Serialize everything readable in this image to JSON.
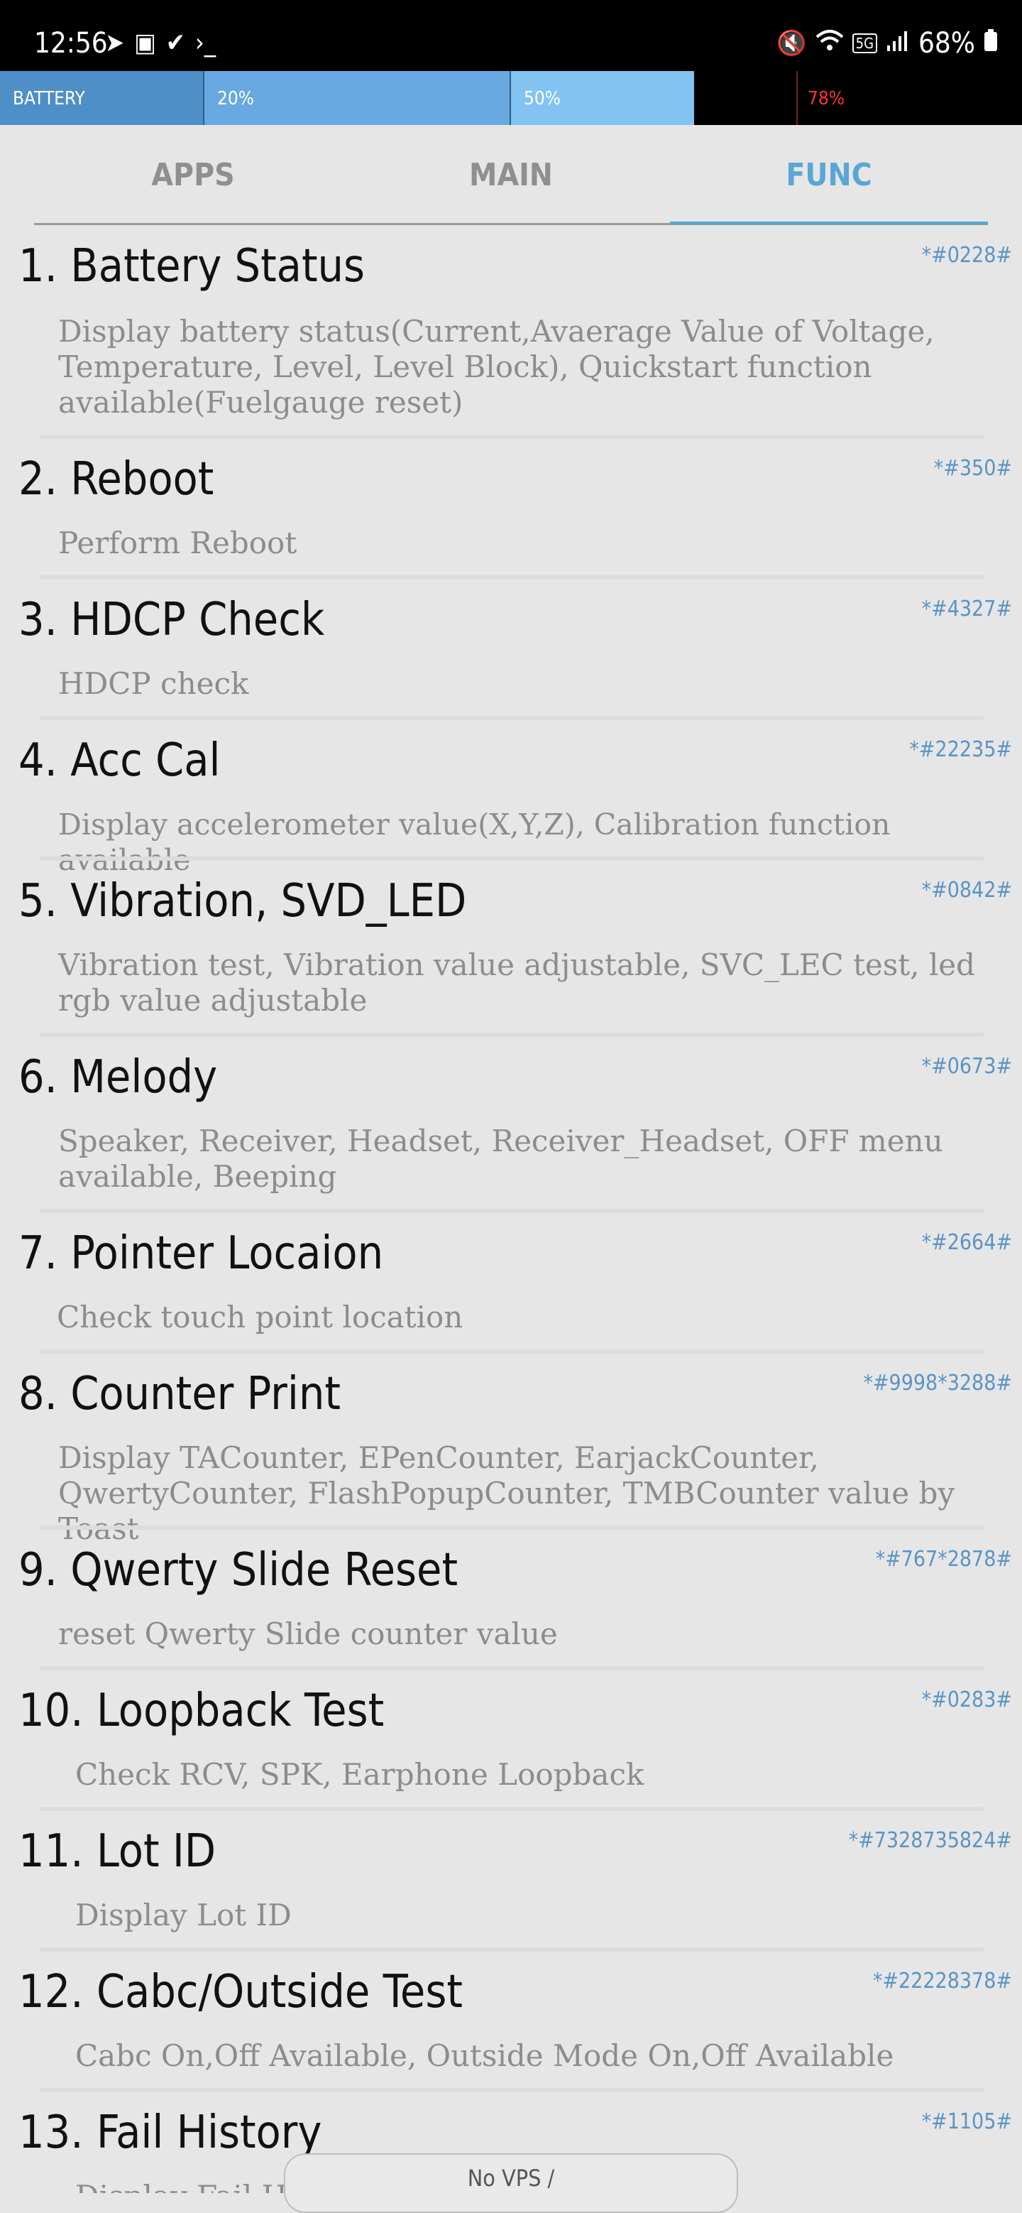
{
  "status_bar": {
    "time": "12:56",
    "battery_percent": "68%",
    "left_icons": [
      "telegram-icon",
      "image-icon",
      "check-icon",
      "terminal-icon"
    ],
    "right_icons": [
      "mute-icon",
      "wifi-icon",
      "5g-icon",
      "signal-icon",
      "battery-icon"
    ]
  },
  "battery_bar": {
    "label": "BATTERY",
    "segment_20": "20%",
    "segment_50": "50%",
    "marker_78": "78%",
    "fill_level_fraction": 0.68
  },
  "tabs": [
    {
      "label": "APPS",
      "active": false
    },
    {
      "label": "MAIN",
      "active": false
    },
    {
      "label": "FUNC",
      "active": true
    }
  ],
  "items": [
    {
      "title": "1.  Battery Status",
      "code": "*#0228#",
      "desc": "Display battery status(Current,Avaerage Value of Voltage, Temperature, Level, Level Block), Quickstart function available(Fuelgauge reset)"
    },
    {
      "title": "2.  Reboot",
      "code": "*#350#",
      "desc": "Perform Reboot"
    },
    {
      "title": "3.  HDCP Check",
      "code": "*#4327#",
      "desc": "HDCP check"
    },
    {
      "title": "4.  Acc Cal",
      "code": "*#22235#",
      "desc": "Display accelerometer value(X,Y,Z), Calibration function available"
    },
    {
      "title": "5.  Vibration, SVD_LED",
      "code": "*#0842#",
      "desc": "Vibration test, Vibration value adjustable, SVC_LEC test, led rgb value adjustable"
    },
    {
      "title": "6.  Melody",
      "code": "*#0673#",
      "desc": "Speaker, Receiver, Headset, Receiver_Headset, OFF menu available, Beeping"
    },
    {
      "title": "7.  Pointer Locaion",
      "code": "*#2664#",
      "desc": "Check touch point location"
    },
    {
      "title": "8.  Counter Print",
      "code": "*#9998*3288#",
      "desc": "Display TACounter, EPenCounter, EarjackCounter, QwertyCounter, FlashPopupCounter, TMBCounter value by Toast"
    },
    {
      "title": "9.  Qwerty Slide Reset",
      "code": "*#767*2878#",
      "desc": "reset Qwerty Slide counter value"
    },
    {
      "title": "10.  Loopback Test",
      "code": "*#0283#",
      "desc": "Check RCV, SPK, Earphone Loopback"
    },
    {
      "title": "11.  Lot ID",
      "code": "*#7328735824#",
      "desc": "Display Lot ID"
    },
    {
      "title": "12.  Cabc/Outside Test",
      "code": "*#22228378#",
      "desc": "Cabc On,Off Available, Outside Mode On,Off Available"
    },
    {
      "title": "13.  Fail History",
      "code": "*#1105#",
      "desc": "Display Fail History"
    }
  ],
  "overlay": {
    "text": "No VPS /"
  }
}
